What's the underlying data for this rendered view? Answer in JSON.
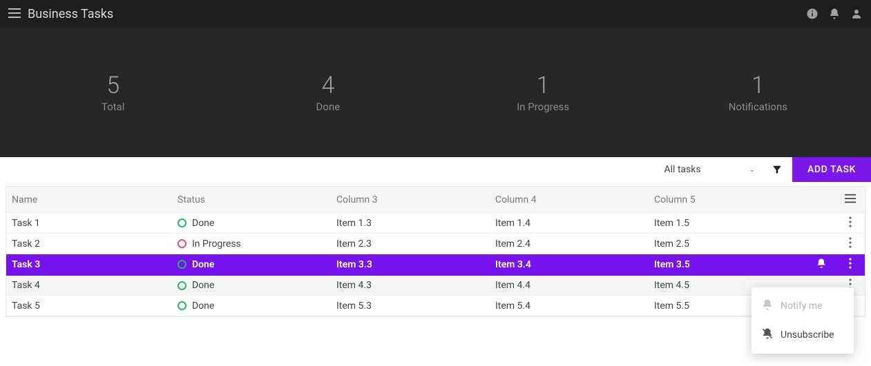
{
  "header": {
    "title": "Business Tasks"
  },
  "stats": [
    {
      "value": "5",
      "label": "Total"
    },
    {
      "value": "4",
      "label": "Done"
    },
    {
      "value": "1",
      "label": "In Progress"
    },
    {
      "value": "1",
      "label": "Notifications"
    }
  ],
  "toolbar": {
    "filter_label": "All tasks",
    "add_task_label": "ADD TASK"
  },
  "table": {
    "columns": [
      "Name",
      "Status",
      "Column 3",
      "Column 4",
      "Column 5"
    ],
    "rows": [
      {
        "name": "Task 1",
        "status": "Done",
        "status_color": "green",
        "c3": "Item 1.3",
        "c4": "Item 1.4",
        "c5": "Item 1.5",
        "active": false,
        "bell": false,
        "alt": false
      },
      {
        "name": "Task 2",
        "status": "In Progress",
        "status_color": "red",
        "c3": "Item 2.3",
        "c4": "Item 2.4",
        "c5": "Item 2.5",
        "active": false,
        "bell": false,
        "alt": false
      },
      {
        "name": "Task 3",
        "status": "Done",
        "status_color": "green",
        "c3": "Item 3.3",
        "c4": "Item 3.4",
        "c5": "Item 3.5",
        "active": true,
        "bell": true,
        "alt": false
      },
      {
        "name": "Task 4",
        "status": "Done",
        "status_color": "green",
        "c3": "Item 4.3",
        "c4": "Item 4.4",
        "c5": "Item 4.5",
        "active": false,
        "bell": false,
        "alt": true
      },
      {
        "name": "Task 5",
        "status": "Done",
        "status_color": "green",
        "c3": "Item 5.3",
        "c4": "Item 5.4",
        "c5": "Item 5.5",
        "active": false,
        "bell": false,
        "alt": false
      }
    ]
  },
  "popup": {
    "notify_label": "Notify me",
    "unsubscribe_label": "Unsubscribe"
  }
}
